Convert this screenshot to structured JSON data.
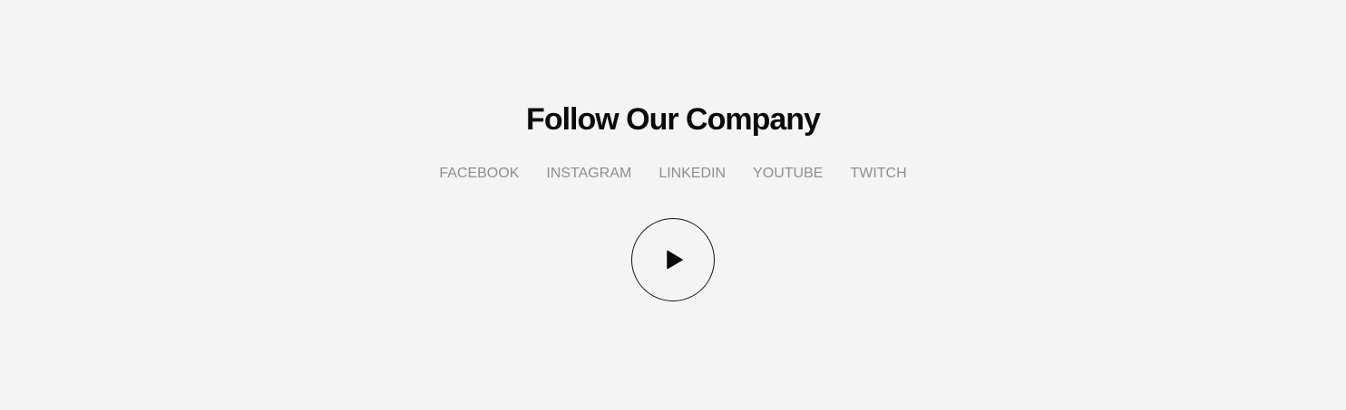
{
  "heading": "Follow Our Company",
  "social_links": [
    {
      "label": "FACEBOOK"
    },
    {
      "label": "INSTAGRAM"
    },
    {
      "label": "LINKEDIN"
    },
    {
      "label": "YOUTUBE"
    },
    {
      "label": "TWITCH"
    }
  ],
  "play_button": {
    "icon": "play-icon"
  },
  "colors": {
    "background": "#f4f4f4",
    "heading": "#0a0a0a",
    "links": "#8f8f8f",
    "button_border": "#111111"
  }
}
